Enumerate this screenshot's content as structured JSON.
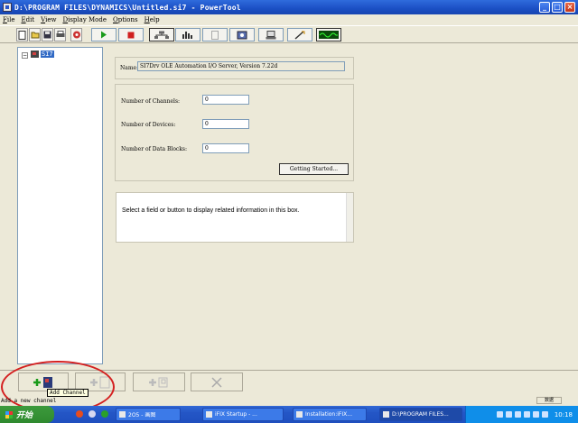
{
  "window": {
    "title": "D:\\PROGRAM FILES\\DYNAMICS\\Untitled.si7 - PowerTool",
    "controls": [
      "_",
      "□",
      "×"
    ]
  },
  "menu": [
    "File",
    "Edit",
    "View",
    "Display Mode",
    "Options",
    "Help"
  ],
  "toolbar": {
    "buttons": [
      "new-icon",
      "open-icon",
      "save-icon",
      "print-icon",
      "help-icon",
      "play-icon",
      "stop-icon",
      "network-icon",
      "chart-icon",
      "document-icon",
      "gear-icon",
      "computer-icon",
      "wand-icon",
      "waveform-icon"
    ]
  },
  "tree": {
    "root_label": "SI7"
  },
  "details": {
    "name_label": "Name:",
    "name_value": "SI7Drv OLE Automation I/O Server, Version 7.22d",
    "channels_label": "Number of Channels:",
    "channels_value": "0",
    "devices_label": "Number of Devices:",
    "devices_value": "0",
    "blocks_label": "Number of Data Blocks:",
    "blocks_value": "0",
    "getting_started": "Getting Started..."
  },
  "info": {
    "text": "Select a field or button to display related information in this box."
  },
  "bottom": {
    "tooltip": "Add Channel",
    "status": "Add a new channel",
    "mode": "数据"
  },
  "taskbar": {
    "start": "开始",
    "tasks": [
      {
        "label": "2O5 - 画图"
      },
      {
        "label": "iFIX Startup - ..."
      },
      {
        "label": "Installation:iFIX..."
      },
      {
        "label": "D:\\PROGRAM FILES..."
      }
    ],
    "clock": "10:18"
  },
  "colors": {
    "titlebar": "#1b4fc4",
    "selection": "#316ac5",
    "highlight_circle": "#d42020",
    "start_green": "#2f8a2f"
  }
}
